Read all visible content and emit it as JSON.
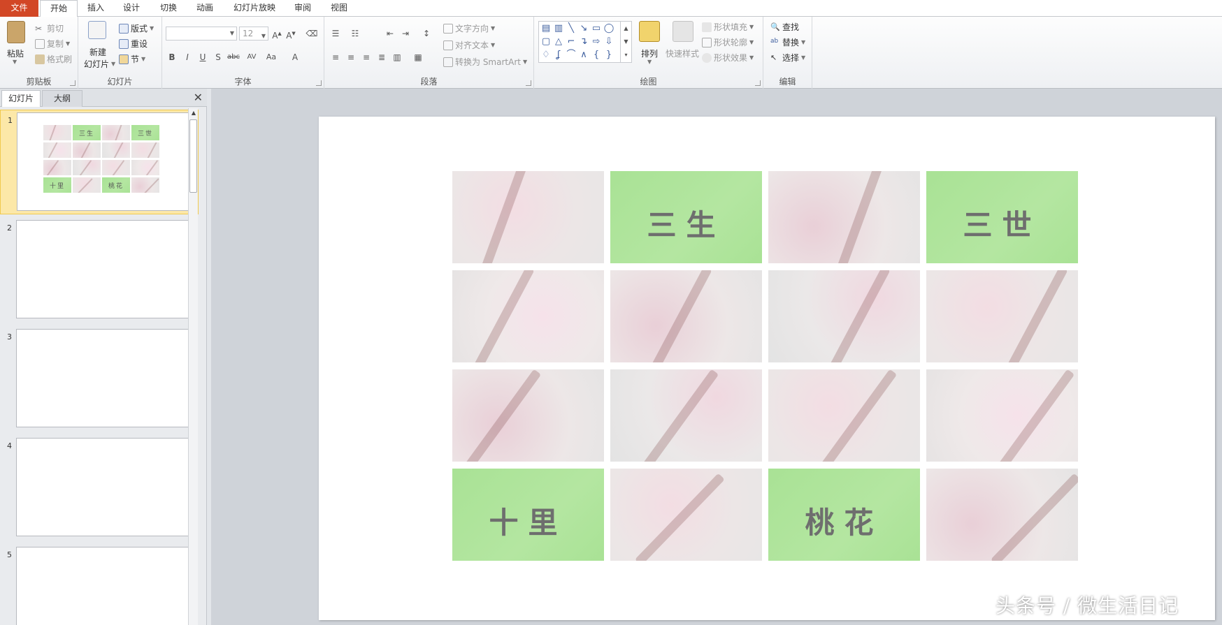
{
  "tabs": [
    "文件",
    "开始",
    "插入",
    "设计",
    "切换",
    "动画",
    "幻灯片放映",
    "审阅",
    "视图"
  ],
  "active_tab_index": 1,
  "ribbon": {
    "clipboard": {
      "label": "剪贴板",
      "paste": "粘贴",
      "cut": "剪切",
      "copy": "复制",
      "format_painter": "格式刷"
    },
    "slides": {
      "label": "幻灯片",
      "new_slide_line1": "新建",
      "new_slide_line2": "幻灯片",
      "layout": "版式",
      "reset": "重设",
      "section": "节"
    },
    "font": {
      "label": "字体",
      "font_name": "",
      "font_size": "12"
    },
    "paragraph": {
      "label": "段落",
      "text_direction": "文字方向",
      "align_text": "对齐文本",
      "convert_smartart": "转换为 SmartArt"
    },
    "drawing": {
      "label": "绘图",
      "arrange": "排列",
      "quick_styles": "快速样式",
      "shape_fill": "形状填充",
      "shape_outline": "形状轮廓",
      "shape_effects": "形状效果"
    },
    "editing": {
      "label": "编辑",
      "find": "查找",
      "replace": "替换",
      "select": "选择"
    }
  },
  "panel": {
    "tabs": [
      "幻灯片",
      "大纲"
    ],
    "active_tab": 0,
    "slides": [
      1,
      2,
      3,
      4,
      5
    ],
    "selected_slide": 1
  },
  "slide": {
    "tiles": [
      {
        "text": "",
        "type": "photo"
      },
      {
        "text": "三生",
        "type": "green"
      },
      {
        "text": "",
        "type": "photo"
      },
      {
        "text": "三世",
        "type": "green"
      },
      {
        "text": "",
        "type": "photo"
      },
      {
        "text": "",
        "type": "photo"
      },
      {
        "text": "",
        "type": "photo"
      },
      {
        "text": "",
        "type": "photo"
      },
      {
        "text": "",
        "type": "photo"
      },
      {
        "text": "",
        "type": "photo"
      },
      {
        "text": "",
        "type": "photo"
      },
      {
        "text": "",
        "type": "photo"
      },
      {
        "text": "十里",
        "type": "green"
      },
      {
        "text": "",
        "type": "photo"
      },
      {
        "text": "桃花",
        "type": "green"
      },
      {
        "text": "",
        "type": "photo"
      }
    ]
  },
  "colors": {
    "file_tab": "#d24726",
    "tile_green": "#a9e295",
    "selection": "#fce8a8"
  },
  "watermark": "头条号 / 微生活日记"
}
